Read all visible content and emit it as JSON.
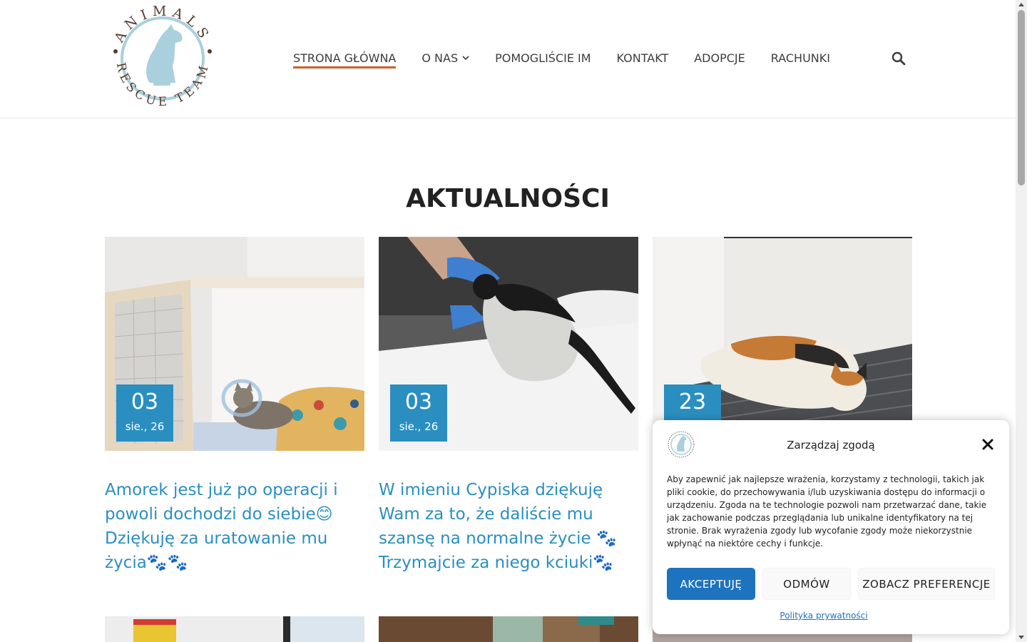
{
  "nav": {
    "items": [
      {
        "label": "STRONA GŁÓWNA",
        "active": true
      },
      {
        "label": "O NAS",
        "dropdown": true
      },
      {
        "label": "POMOGLIŚCIE IM"
      },
      {
        "label": "KONTAKT"
      },
      {
        "label": "ADOPCJE"
      },
      {
        "label": "RACHUNKI"
      }
    ],
    "search_icon": "search-icon"
  },
  "logo": {
    "top_text": "ANIMALS",
    "bottom_text": "RESCUE TEAM"
  },
  "section": {
    "title": "AKTUALNOŚCI"
  },
  "posts": [
    {
      "day": "03",
      "month": "sie., 26",
      "title": "Amorek jest już po operacji i powoli dochodzi do siebie😊 Dziękuję za uratowanie mu życia🐾🐾"
    },
    {
      "day": "03",
      "month": "sie., 26",
      "title": "W imieniu Cypiska dziękuję Wam za to, że daliście mu szansę na normalne życie 🐾 Trzymajcie za niego kciuki🐾"
    },
    {
      "day": "23",
      "month": "",
      "title": ""
    }
  ],
  "consent": {
    "title": "Zarządzaj zgodą",
    "text": "Aby zapewnić jak najlepsze wrażenia, korzystamy z technologii, takich jak pliki cookie, do przechowywania i/lub uzyskiwania dostępu do informacji o urządzeniu. Zgoda na te technologie pozwoli nam przetwarzać dane, takie jak zachowanie podczas przeglądania lub unikalne identyfikatory na tej stronie. Brak wyrażenia zgody lub wycofanie zgody może niekorzystnie wpłynąć na niektóre cechy i funkcje.",
    "accept": "AKCEPTUJĘ",
    "deny": "ODMÓW",
    "preferences": "ZOBACZ PREFERENCJE",
    "privacy": "Polityka prywatności"
  },
  "colors": {
    "accent": "#2a8fc0",
    "nav_underline": "#c7652a",
    "accept_button": "#1e73be",
    "logo_blue": "#a9d0dc",
    "logo_brown": "#5b3b2e"
  }
}
